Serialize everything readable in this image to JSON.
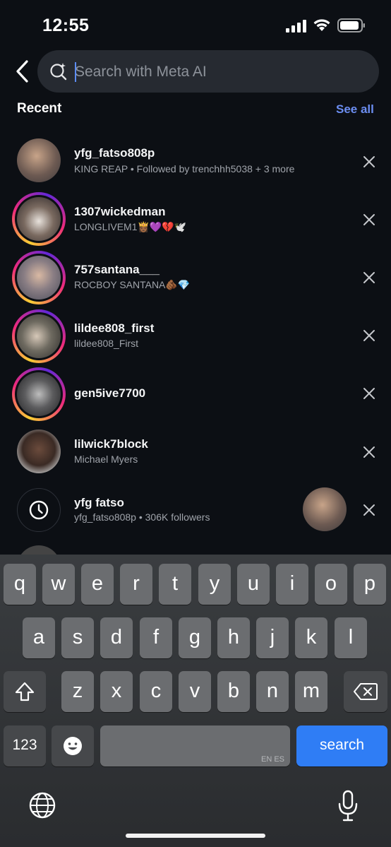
{
  "status": {
    "time": "12:55"
  },
  "search": {
    "placeholder": "Search with Meta AI"
  },
  "recent": {
    "title": "Recent",
    "see_all": "See all"
  },
  "items": [
    {
      "username": "yfg_fatso808p",
      "subtitle": "KING REAP • Followed by trenchhh5038 + 3 more",
      "story_ring": false
    },
    {
      "username": "1307wickedman",
      "subtitle": "LONGLIVEM1👸🏾💜💔🕊️",
      "story_ring": true
    },
    {
      "username": "757santana___",
      "subtitle": "ROCBOY SANTANA🫵🏾💎",
      "story_ring": true
    },
    {
      "username": "lildee808_first",
      "subtitle": "lildee808_First",
      "story_ring": true
    },
    {
      "username": "gen5ive7700",
      "subtitle": "",
      "story_ring": true
    },
    {
      "username": "lilwick7block",
      "subtitle": "Michael Myers",
      "story_ring": false
    },
    {
      "username": "yfg fatso",
      "subtitle": "yfg_fatso808p • 306K followers",
      "story_ring": false,
      "icon": "clock-icon"
    }
  ],
  "keyboard": {
    "row1": [
      "q",
      "w",
      "e",
      "r",
      "t",
      "y",
      "u",
      "i",
      "o",
      "p"
    ],
    "row2": [
      "a",
      "s",
      "d",
      "f",
      "g",
      "h",
      "j",
      "k",
      "l"
    ],
    "row3": [
      "z",
      "x",
      "c",
      "v",
      "b",
      "n",
      "m"
    ],
    "numbers_label": "123",
    "space_lang": "EN ES",
    "search_label": "search"
  }
}
